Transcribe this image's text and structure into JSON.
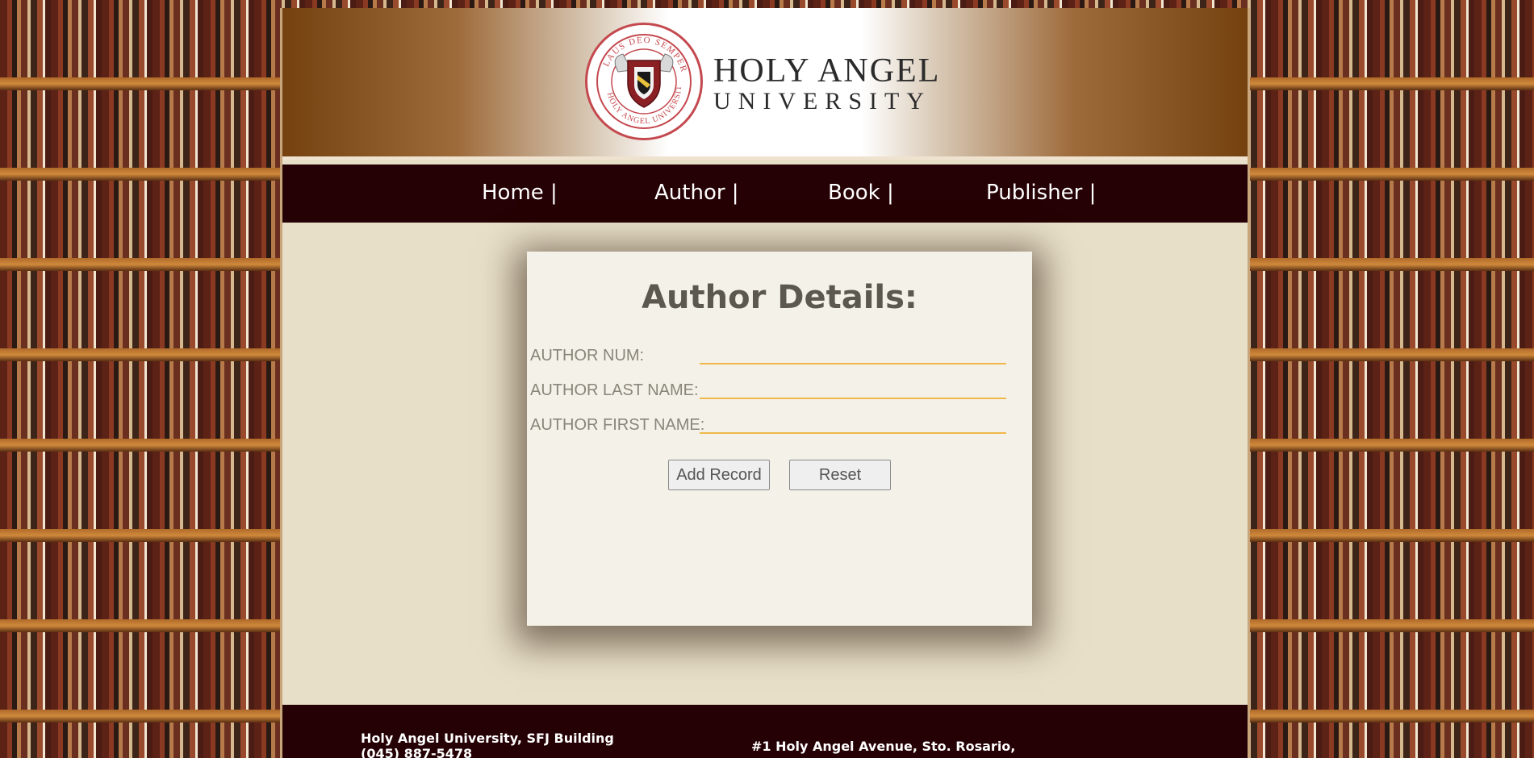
{
  "header": {
    "logo_line1": "HOLY ANGEL",
    "logo_line2": "UNIVERSITY",
    "seal_text_top": "LAUS DEO SEMPER",
    "seal_text_bottom": "HOLY ANGEL UNIVERSITY"
  },
  "nav": {
    "items": [
      {
        "label": "Home |"
      },
      {
        "label": "Author |"
      },
      {
        "label": "Book |"
      },
      {
        "label": "Publisher |"
      }
    ]
  },
  "form": {
    "title": "Author Details:",
    "fields": [
      {
        "label": "AUTHOR NUM:",
        "value": ""
      },
      {
        "label": "AUTHOR LAST NAME:",
        "value": ""
      },
      {
        "label": "AUTHOR FIRST NAME:",
        "value": ""
      }
    ],
    "add_button": "Add Record",
    "reset_button": "Reset"
  },
  "footer": {
    "left_line1": "Holy Angel University, SFJ Building",
    "left_line2": "(045) 887-5478",
    "right_line1": "#1 Holy Angel Avenue, Sto. Rosario,"
  },
  "colors": {
    "nav_bg": "#250004",
    "content_bg": "#e7dfc8",
    "card_bg": "#f4f1e9",
    "input_underline": "#f0b84a",
    "banner_brown": "#74410f"
  }
}
